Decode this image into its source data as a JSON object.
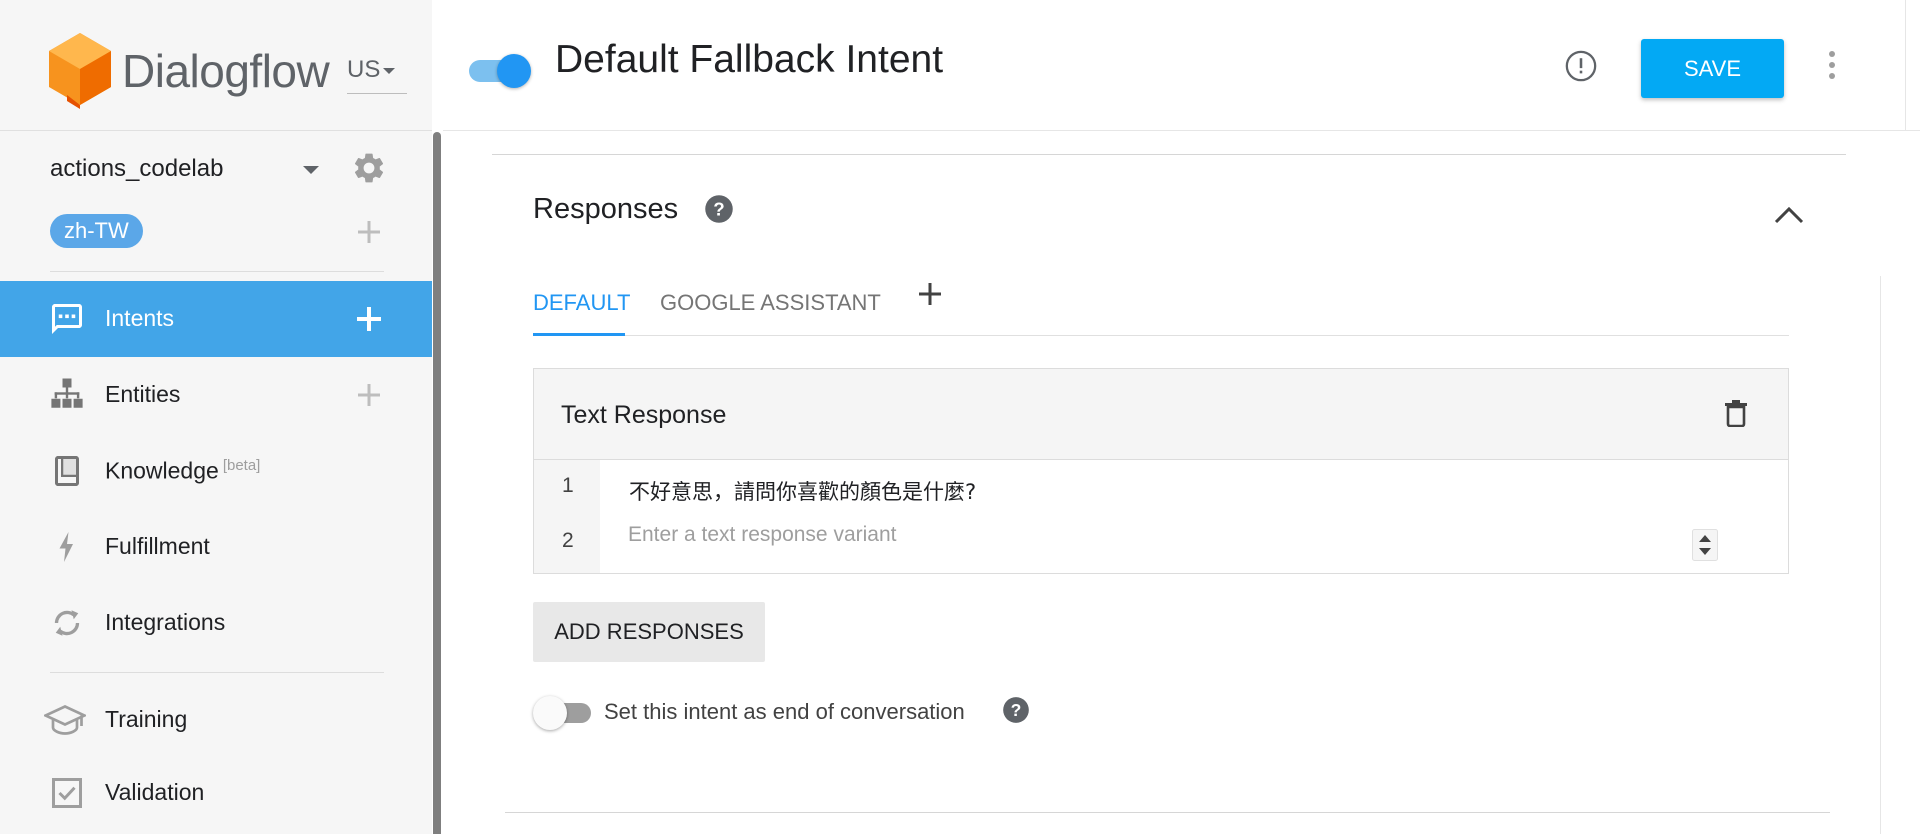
{
  "app": {
    "logo_text": "Dialogflow",
    "region": "US"
  },
  "sidebar": {
    "agent_name": "actions_codelab",
    "language_chip": "zh-TW",
    "items": [
      {
        "label": "Intents",
        "icon": "intents-icon",
        "active": true,
        "addable": true
      },
      {
        "label": "Entities",
        "icon": "entities-icon",
        "active": false,
        "addable": true
      },
      {
        "label": "Knowledge",
        "icon": "knowledge-icon",
        "badge": "[beta]",
        "active": false
      },
      {
        "label": "Fulfillment",
        "icon": "fulfillment-icon",
        "active": false
      },
      {
        "label": "Integrations",
        "icon": "integrations-icon",
        "active": false
      },
      {
        "label": "Training",
        "icon": "training-icon",
        "active": false
      },
      {
        "label": "Validation",
        "icon": "validation-icon",
        "active": false
      }
    ]
  },
  "header": {
    "intent_enabled": true,
    "title": "Default Fallback Intent",
    "save_label": "SAVE"
  },
  "responses": {
    "title": "Responses",
    "tabs": [
      {
        "label": "DEFAULT",
        "active": true
      },
      {
        "label": "GOOGLE ASSISTANT",
        "active": false
      }
    ],
    "card": {
      "title": "Text Response",
      "rows": [
        {
          "num": "1",
          "text": "不好意思，請問你喜歡的顏色是什麼?"
        },
        {
          "num": "2",
          "text": "",
          "placeholder": "Enter a text response variant"
        }
      ]
    },
    "add_button": "ADD RESPONSES",
    "end_conversation": {
      "label": "Set this intent as end of conversation",
      "enabled": false
    }
  },
  "colors": {
    "accent": "#2196f3",
    "save_button": "#03a9f4",
    "active_nav": "#42a5e8",
    "sidebar_bg": "#f6f6f6",
    "logo_orange": "#ef6c00"
  }
}
